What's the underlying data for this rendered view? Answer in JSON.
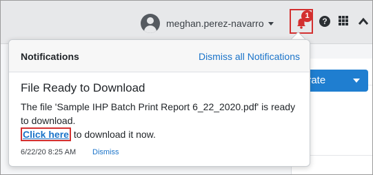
{
  "header": {
    "username": "meghan.perez-navarro",
    "notification_count": "1",
    "icons": {
      "avatar": "user-avatar",
      "bell": "bell-icon",
      "help": "question-circle-icon",
      "apps": "grid-icon",
      "collapse": "chevron-up-icon"
    },
    "help_glyph": "?"
  },
  "background": {
    "generate_button_label": "erate"
  },
  "notifications": {
    "title": "Notifications",
    "dismiss_all_label": "Dismiss all Notifications",
    "items": [
      {
        "title": "File Ready to Download",
        "message": "The file 'Sample IHP Batch Print Report 6_22_2020.pdf' is ready to download.",
        "link_label": "Click here",
        "link_suffix": " to download it now.",
        "timestamp": "6/22/20 8:25 AM",
        "dismiss_label": "Dismiss"
      }
    ]
  },
  "colors": {
    "accent_blue": "#1a73c9",
    "highlight_red": "#d32f2f",
    "primary_button": "#1f7ed0"
  }
}
